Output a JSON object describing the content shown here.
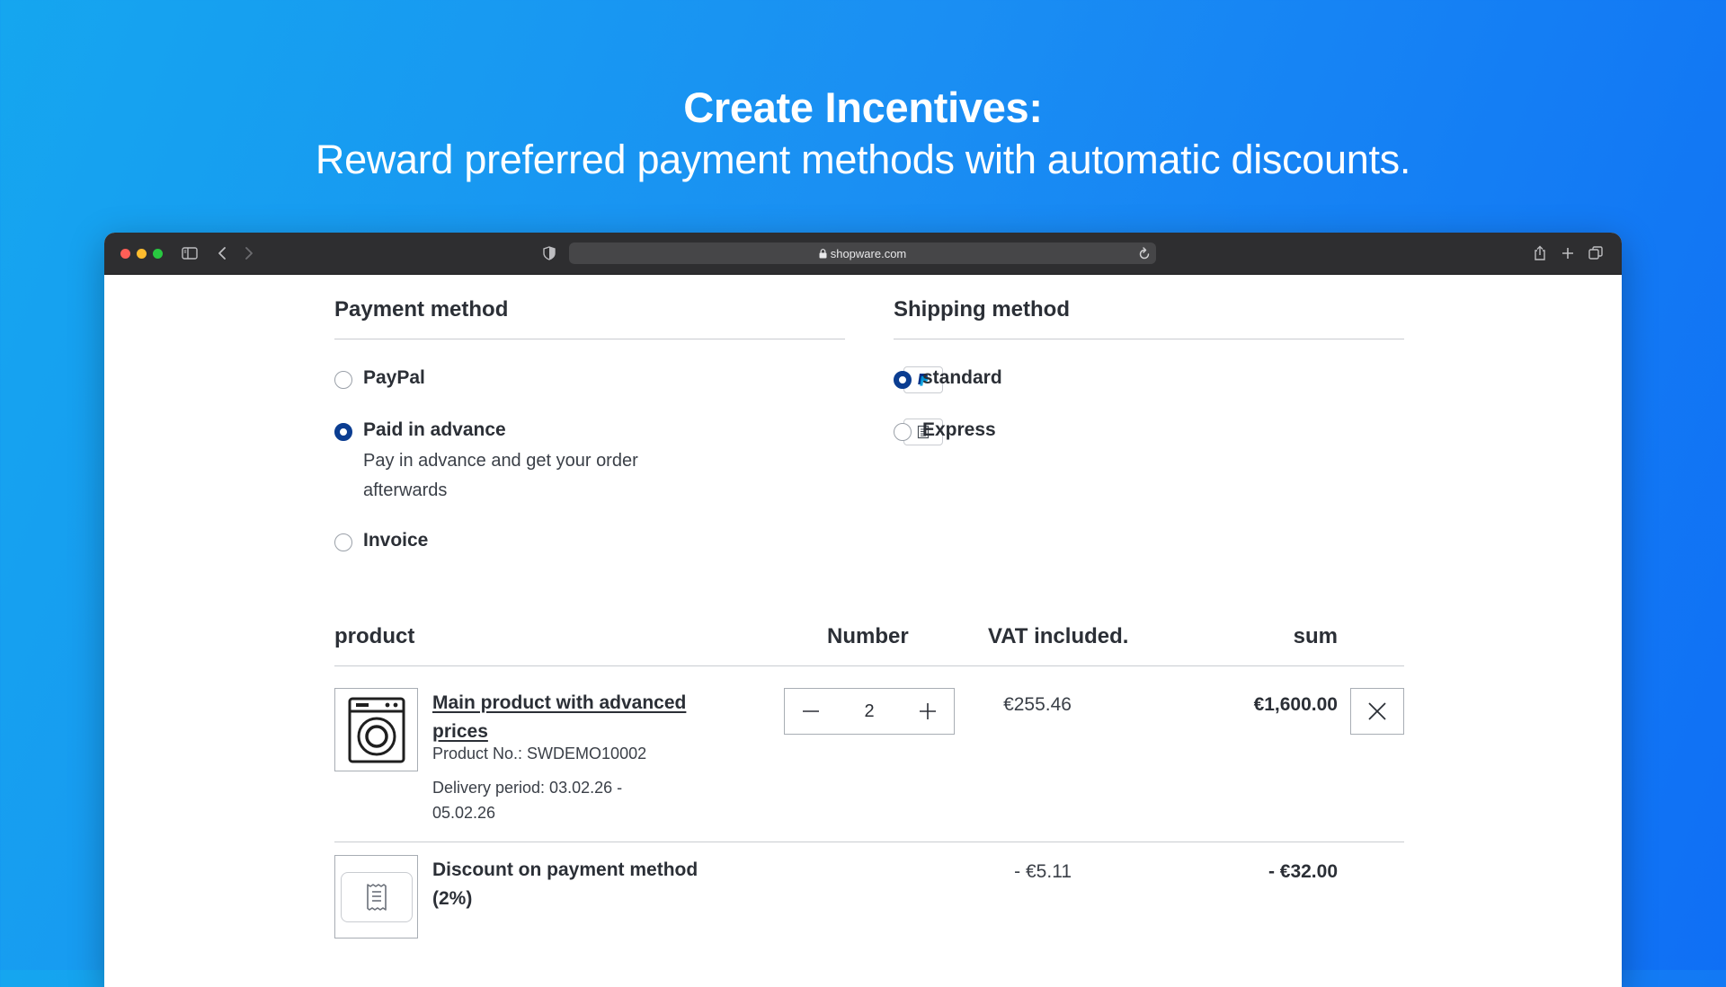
{
  "hero": {
    "title": "Create Incentives:",
    "subtitle": "Reward preferred payment methods with automatic discounts."
  },
  "browser": {
    "url": "shopware.com",
    "icons": [
      "sidebar-icon",
      "back-icon",
      "forward-icon",
      "shield-icon",
      "lock-icon",
      "reload-icon",
      "share-icon",
      "new-tab-icon",
      "tabs-icon"
    ]
  },
  "payment": {
    "heading": "Payment method",
    "options": [
      {
        "label": "PayPal",
        "selected": false,
        "icon": "paypal-icon"
      },
      {
        "label": "Paid in advance",
        "description": "Pay in advance and get your order afterwards",
        "selected": true,
        "icon": "document-icon"
      },
      {
        "label": "Invoice",
        "selected": false
      }
    ]
  },
  "shipping": {
    "heading": "Shipping method",
    "options": [
      {
        "label": "standard",
        "selected": true
      },
      {
        "label": "Express",
        "selected": false
      }
    ]
  },
  "cart": {
    "headers": {
      "product": "product",
      "number": "Number",
      "vat": "VAT included.",
      "sum": "sum"
    },
    "items": [
      {
        "name": "Main product with advanced prices",
        "product_no": "Product No.: SWDEMO10002",
        "delivery": "Delivery period: 03.02.26 - 05.02.26",
        "quantity": "2",
        "vat": "€255.46",
        "sum": "€1,600.00",
        "icon": "washing-machine-icon"
      }
    ],
    "discount": {
      "name": "Discount on payment method (2%)",
      "vat": "- €5.11",
      "sum": "- €32.00",
      "icon": "receipt-icon"
    }
  },
  "colors": {
    "accent": "#0b3d91",
    "background_start": "#15a6ef",
    "background_end": "#0f6ff5",
    "paypal_dark": "#003087",
    "paypal_light": "#009cde"
  }
}
